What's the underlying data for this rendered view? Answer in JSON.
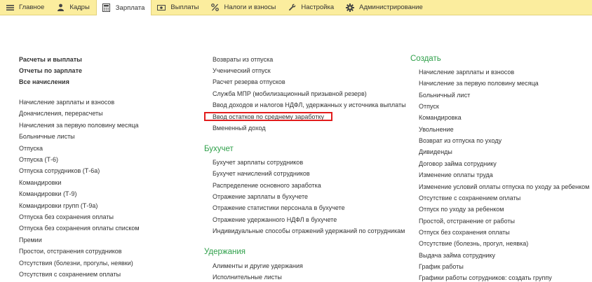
{
  "tabs": [
    {
      "label": "Главное",
      "icon": "hamburger-icon"
    },
    {
      "label": "Кадры",
      "icon": "person-icon"
    },
    {
      "label": "Зарплата",
      "icon": "calculator-icon",
      "active": true
    },
    {
      "label": "Выплаты",
      "icon": "cash-icon"
    },
    {
      "label": "Налоги и взносы",
      "icon": "percent-icon"
    },
    {
      "label": "Настройка",
      "icon": "wrench-icon"
    },
    {
      "label": "Администрирование",
      "icon": "gear-icon"
    }
  ],
  "col1": {
    "bold_links": [
      "Расчеты и выплаты",
      "Отчеты по зарплате",
      "Все начисления"
    ],
    "links": [
      "Начисление зарплаты и взносов",
      "Доначисления, перерасчеты",
      "Начисления за первую половину месяца",
      "Больничные листы",
      "Отпуска",
      "Отпуска (Т-6)",
      "Отпуска сотрудников (Т-6а)",
      "Командировки",
      "Командировки (Т-9)",
      "Командировки групп (Т-9а)",
      "Отпуска без сохранения оплаты",
      "Отпуска без сохранения оплаты списком",
      "Премии",
      "Простои, отстранения сотрудников",
      "Отсутствия (болезни, прогулы, неявки)",
      "Отсутствия с сохранением оплаты"
    ]
  },
  "col2": {
    "links": [
      "Возвраты из отпуска",
      "Ученический отпуск",
      "Расчет резерва отпусков",
      "Служба МПР (мобилизационный призывной резерв)",
      "Ввод доходов и налогов НДФЛ, удержанных у источника выплаты",
      "Ввод остатков по среднему заработку",
      "Вмененный доход"
    ],
    "section_buh": "Бухучет",
    "buh_links": [
      "Бухучет зарплаты сотрудников",
      "Бухучет начислений сотрудников",
      "Распределение основного заработка",
      "Отражение зарплаты в бухучете",
      "Отражение статистики персонала в бухучете",
      "Отражение удержанного НДФЛ в бухучете",
      "Индивидуальные способы отражений удержаний по сотрудникам"
    ],
    "section_uderzh": "Удержания",
    "uderzh_links": [
      "Алименты и другие удержания",
      "Исполнительные листы"
    ]
  },
  "col3": {
    "section_create": "Создать",
    "links": [
      "Начисление зарплаты и взносов",
      "Начисление за первую половину месяца",
      "Больничный лист",
      "Отпуск",
      "Командировка",
      "Увольнение",
      "Возврат из отпуска по уходу",
      "Дивиденды",
      "Договор займа сотруднику",
      "Изменение оплаты труда",
      "Изменение условий оплаты отпуска по уходу за ребенком",
      "Отсутствие с сохранением оплаты",
      "Отпуск по уходу за ребенком",
      "Простой, отстранение от работы",
      "Отпуск без сохранения оплаты",
      "Отсутствие (болезнь, прогул, неявка)",
      "Выдача займа сотруднику",
      "График работы",
      "Графики работы сотрудников: создать группу"
    ]
  },
  "colors": {
    "topbar": "#fbed9e",
    "section": "#2fa04a",
    "highlight": "#e21c1c"
  }
}
